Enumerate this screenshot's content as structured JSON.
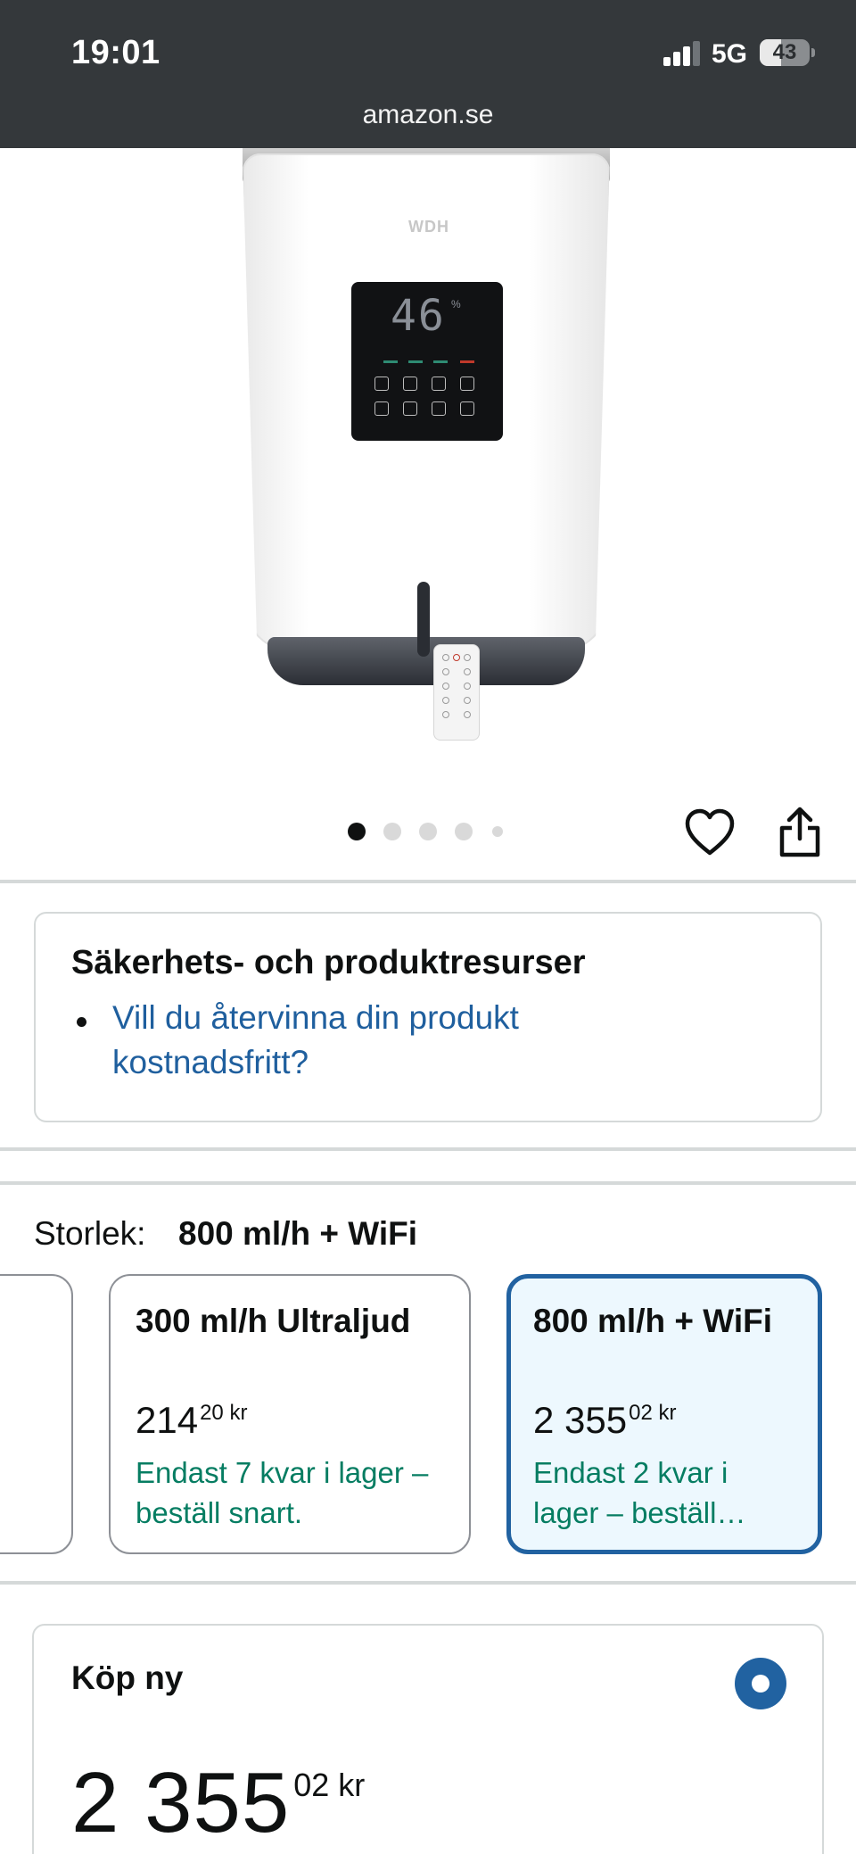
{
  "status_bar": {
    "time": "19:01",
    "network": "5G",
    "battery_level": "43",
    "signal_bars_active": 3,
    "signal_bars_total": 4
  },
  "browser": {
    "url": "amazon.se"
  },
  "product_image": {
    "brand": "WDH",
    "display_reading": "46",
    "display_unit": "%",
    "image_count": 5,
    "active_index": 0
  },
  "actions": {
    "wishlist_icon": "heart-icon",
    "share_icon": "share-icon"
  },
  "safety": {
    "title": "Säkerhets- och produktresurser",
    "link": "Vill du återvinna din produkt kostnadsfritt?"
  },
  "size": {
    "label": "Storlek:",
    "selected": "800 ml/h + WiFi",
    "options": [
      {
        "name": "",
        "price_main": "",
        "price_cents": "",
        "currency": "",
        "stock": ""
      },
      {
        "name": "300 ml/h Ultraljud",
        "price_main": "214",
        "price_cents": "20",
        "currency": "kr",
        "stock": "Endast 7 kvar i lager – beställ snart."
      },
      {
        "name": "800 ml/h + WiFi",
        "price_main": "2 355",
        "price_cents": "02",
        "currency": "kr",
        "stock": "Endast 2 kvar i lager – beställ…"
      }
    ]
  },
  "buy_box": {
    "title": "Köp ny",
    "price_main": "2 355",
    "price_cents": "02",
    "currency": "kr"
  },
  "colors": {
    "status_bar_bg": "#34383b",
    "link": "#1f5f9e",
    "stock_green": "#067d62",
    "selected_border": "#2162a1",
    "selected_bg": "#edf8fe"
  }
}
